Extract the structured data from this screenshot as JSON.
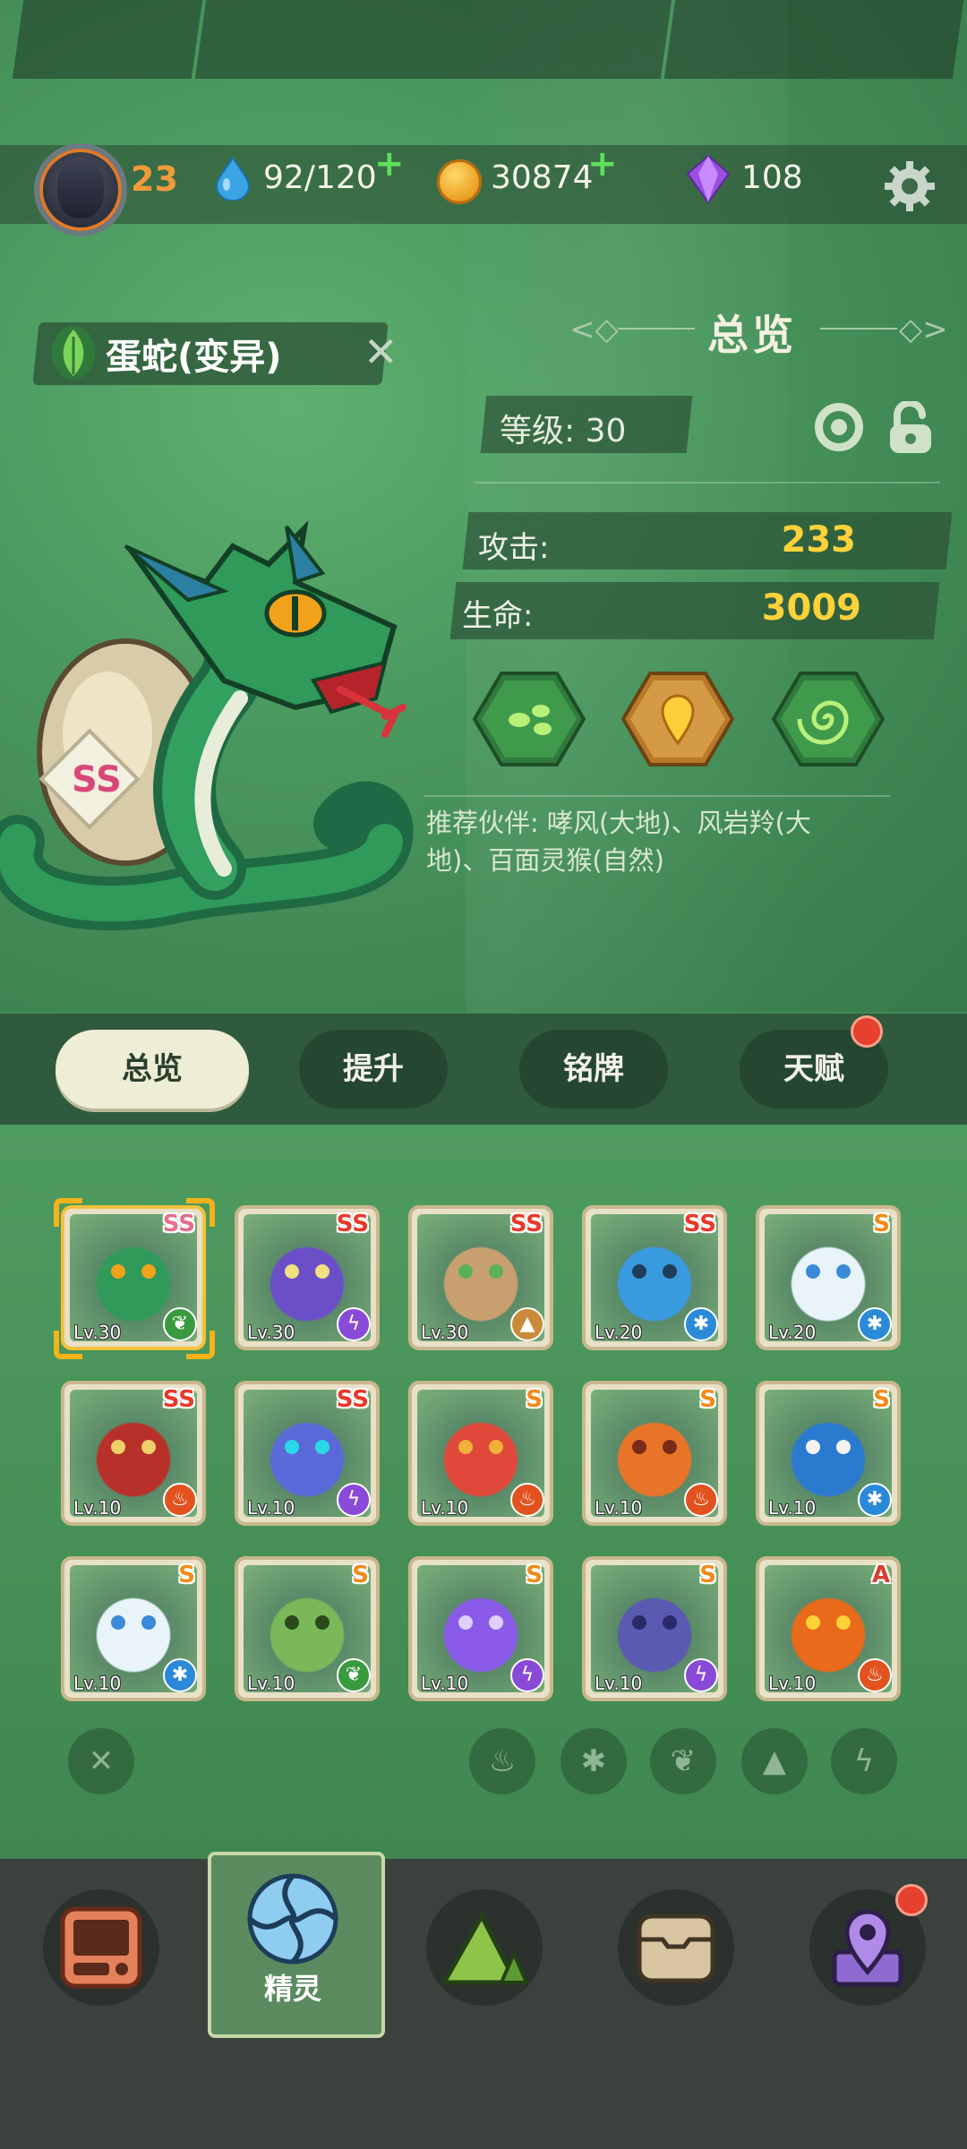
{
  "player": {
    "level": "23"
  },
  "resources": {
    "energy": "92/120",
    "coins": "30874",
    "gems": "108"
  },
  "creature": {
    "name": "蛋蛇(变异)",
    "rank": "SS",
    "element": "leaf"
  },
  "overview": {
    "title": "总览",
    "level_label": "等级: 30",
    "stats": [
      {
        "label": "攻击:",
        "value": "233"
      },
      {
        "label": "生命:",
        "value": "3009"
      }
    ],
    "skills": [
      {
        "name": "seed-skill-icon",
        "color": "#2f7a3c"
      },
      {
        "name": "bulb-skill-icon",
        "color": "#b8792a"
      },
      {
        "name": "swirl-skill-icon",
        "color": "#2f7a3c"
      }
    ],
    "recommend_line1": "推荐伙伴: 哮风(大地)、风岩羚(大",
    "recommend_line2": "地)、百面灵猴(自然)"
  },
  "tabs": [
    {
      "label": "总览",
      "active": true
    },
    {
      "label": "提升",
      "active": false
    },
    {
      "label": "铭牌",
      "active": false
    },
    {
      "label": "天赋",
      "active": false,
      "badge": true
    }
  ],
  "roster": [
    {
      "rank": "SS",
      "level": "Lv.30",
      "element": "leaf",
      "art": "green-snake",
      "selected": true
    },
    {
      "rank": "SS",
      "level": "Lv.30",
      "element": "thunder",
      "art": "purple-cat"
    },
    {
      "rank": "SS",
      "level": "Lv.30",
      "element": "earth",
      "art": "goat"
    },
    {
      "rank": "SS",
      "level": "Lv.20",
      "element": "frost",
      "art": "blue-dragon"
    },
    {
      "rank": "S",
      "level": "Lv.20",
      "element": "frost",
      "art": "white-cat"
    },
    {
      "rank": "SS",
      "level": "Lv.10",
      "element": "fire",
      "art": "red-bull"
    },
    {
      "rank": "SS",
      "level": "Lv.10",
      "element": "thunder",
      "art": "cannon"
    },
    {
      "rank": "S",
      "level": "Lv.10",
      "element": "fire",
      "art": "red-blob"
    },
    {
      "rank": "S",
      "level": "Lv.10",
      "element": "fire",
      "art": "lava-blob"
    },
    {
      "rank": "S",
      "level": "Lv.10",
      "element": "frost",
      "art": "owl"
    },
    {
      "rank": "S",
      "level": "Lv.10",
      "element": "frost",
      "art": "white-cat"
    },
    {
      "rank": "S",
      "level": "Lv.10",
      "element": "leaf",
      "art": "green-beast"
    },
    {
      "rank": "S",
      "level": "Lv.10",
      "element": "thunder",
      "art": "jellyfish"
    },
    {
      "rank": "S",
      "level": "Lv.10",
      "element": "thunder",
      "art": "croc"
    },
    {
      "rank": "A",
      "level": "Lv.10",
      "element": "fire",
      "art": "fire-sprite"
    }
  ],
  "filters": [
    "clear-filter-icon",
    "fire-filter-icon",
    "frost-filter-icon",
    "leaf-filter-icon",
    "earth-filter-icon",
    "thunder-filter-icon"
  ],
  "bottom_nav": [
    {
      "icon": "console-icon"
    },
    {
      "icon": "spirit-icon",
      "label": "精灵",
      "active": true
    },
    {
      "icon": "mountain-icon"
    },
    {
      "icon": "chest-icon"
    },
    {
      "icon": "map-pin-icon",
      "badge": true
    }
  ],
  "colors": {
    "background": "#4b9a60",
    "stat_value": "#ffd23a",
    "level_orange": "#f29a3a",
    "badge_red": "#e6412e"
  }
}
